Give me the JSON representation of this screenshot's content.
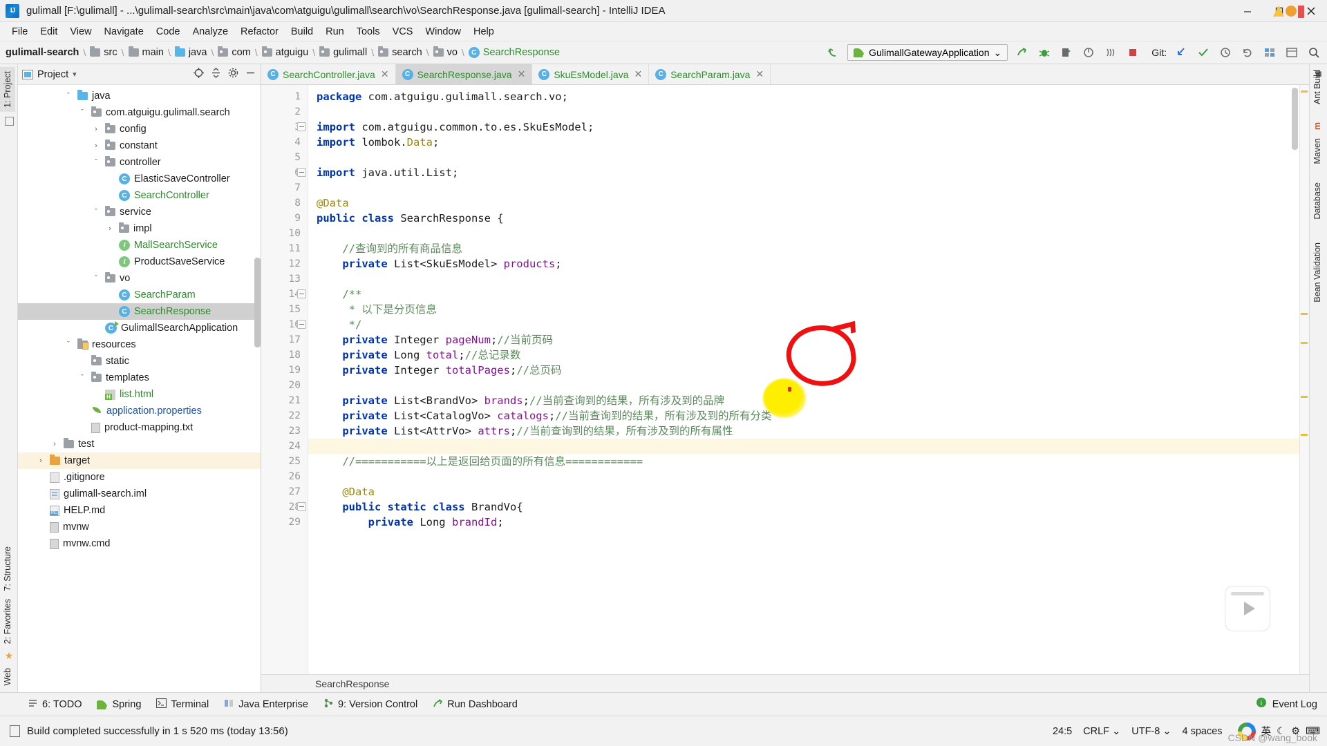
{
  "window": {
    "title": "gulimall [F:\\gulimall] - ...\\gulimall-search\\src\\main\\java\\com\\atguigu\\gulimall\\search\\vo\\SearchResponse.java [gulimall-search] - IntelliJ IDEA",
    "logo_text": "IJ",
    "minimize": "─",
    "maximize": "❐",
    "close": "✕"
  },
  "menu": {
    "items": [
      "File",
      "Edit",
      "View",
      "Navigate",
      "Code",
      "Analyze",
      "Refactor",
      "Build",
      "Run",
      "Tools",
      "VCS",
      "Window",
      "Help"
    ]
  },
  "breadcrumb": {
    "items": [
      {
        "label": "gulimall-search",
        "icon": "module-icon",
        "type": "root"
      },
      {
        "label": "src",
        "icon": "folder-icon",
        "type": "folder"
      },
      {
        "label": "main",
        "icon": "folder-icon",
        "type": "folder"
      },
      {
        "label": "java",
        "icon": "source-folder-icon",
        "type": "source"
      },
      {
        "label": "com",
        "icon": "package-icon",
        "type": "folder"
      },
      {
        "label": "atguigu",
        "icon": "package-icon",
        "type": "folder"
      },
      {
        "label": "gulimall",
        "icon": "package-icon",
        "type": "folder"
      },
      {
        "label": "search",
        "icon": "package-icon",
        "type": "folder"
      },
      {
        "label": "vo",
        "icon": "package-icon",
        "type": "folder"
      },
      {
        "label": "SearchResponse",
        "icon": "class-icon",
        "type": "class"
      }
    ],
    "separator": "\\"
  },
  "toolbar": {
    "back_icon": "undo-arrow-icon",
    "run_config": {
      "label": "GulimallGatewayApplication",
      "icon": "spring-boot-icon",
      "chevron": "⌄"
    },
    "buttons": [
      {
        "name": "run-button",
        "glyph": "➤"
      },
      {
        "name": "debug-button",
        "glyph": "☣"
      },
      {
        "name": "run-with-coverage-button",
        "glyph": "◧"
      },
      {
        "name": "profile-button",
        "glyph": "◔"
      },
      {
        "name": "attach-process-button",
        "glyph": "⫷"
      },
      {
        "name": "stop-button",
        "glyph": "■"
      }
    ],
    "git_label": "Git:",
    "git_buttons": [
      {
        "name": "update-project-button",
        "glyph": "↙"
      },
      {
        "name": "commit-button",
        "glyph": "✓"
      },
      {
        "name": "history-button",
        "glyph": "◴"
      },
      {
        "name": "rollback-button",
        "glyph": "↺"
      }
    ],
    "right_buttons": [
      {
        "name": "settings-button",
        "glyph": "▦"
      },
      {
        "name": "project-structure-button",
        "glyph": "◫"
      },
      {
        "name": "search-everywhere-button",
        "glyph": "⌕"
      }
    ]
  },
  "left_strip": {
    "top_items": [
      {
        "label": "1: Project",
        "selected": true
      },
      {
        "label": "",
        "selected": false
      }
    ],
    "bottom_items": [
      {
        "label": "7: Structure"
      },
      {
        "label": "2: Favorites"
      },
      {
        "label": "Web"
      }
    ]
  },
  "right_strip": {
    "items": [
      {
        "label": "Ant Build"
      },
      {
        "label": "m"
      },
      {
        "label": "Maven"
      },
      {
        "label": "Database"
      },
      {
        "label": "Bean Validation"
      }
    ]
  },
  "project_panel": {
    "header": {
      "title": "Project",
      "chevron": "▾",
      "icons": [
        {
          "name": "scroll-from-source-icon",
          "glyph": "⊕"
        },
        {
          "name": "collapse-all-icon",
          "glyph": "≡"
        },
        {
          "name": "settings-gear-icon",
          "glyph": "⚙"
        },
        {
          "name": "hide-panel-icon",
          "glyph": "─"
        }
      ]
    },
    "tree": [
      {
        "label": "java",
        "indent": 3,
        "chev": "ˇ",
        "icon": "source-folder-icon",
        "color": "dark"
      },
      {
        "label": "com.atguigu.gulimall.search",
        "indent": 4,
        "chev": "ˇ",
        "icon": "package-icon",
        "color": "dark"
      },
      {
        "label": "config",
        "indent": 5,
        "chev": "›",
        "icon": "package-icon",
        "color": "dark"
      },
      {
        "label": "constant",
        "indent": 5,
        "chev": "›",
        "icon": "package-icon",
        "color": "dark"
      },
      {
        "label": "controller",
        "indent": 5,
        "chev": "ˇ",
        "icon": "package-icon",
        "color": "dark"
      },
      {
        "label": "ElasticSaveController",
        "indent": 6,
        "chev": "",
        "icon": "class-icon",
        "color": "dark"
      },
      {
        "label": "SearchController",
        "indent": 6,
        "chev": "",
        "icon": "class-icon",
        "color": "green"
      },
      {
        "label": "service",
        "indent": 5,
        "chev": "ˇ",
        "icon": "package-icon",
        "color": "dark"
      },
      {
        "label": "impl",
        "indent": 6,
        "chev": "›",
        "icon": "package-icon",
        "color": "dark"
      },
      {
        "label": "MallSearchService",
        "indent": 6,
        "chev": "",
        "icon": "interface-icon",
        "color": "green"
      },
      {
        "label": "ProductSaveService",
        "indent": 6,
        "chev": "",
        "icon": "interface-icon",
        "color": "dark"
      },
      {
        "label": "vo",
        "indent": 5,
        "chev": "ˇ",
        "icon": "package-icon",
        "color": "dark"
      },
      {
        "label": "SearchParam",
        "indent": 6,
        "chev": "",
        "icon": "class-icon",
        "color": "green"
      },
      {
        "label": "SearchResponse",
        "indent": 6,
        "chev": "",
        "icon": "class-icon",
        "color": "green",
        "selected": true
      },
      {
        "label": "GulimallSearchApplication",
        "indent": 5,
        "chev": "",
        "icon": "spring-app-icon",
        "color": "dark"
      },
      {
        "label": "resources",
        "indent": 3,
        "chev": "ˇ",
        "icon": "resources-folder-icon",
        "color": "dark"
      },
      {
        "label": "static",
        "indent": 4,
        "chev": "",
        "icon": "package-icon",
        "color": "dark"
      },
      {
        "label": "templates",
        "indent": 4,
        "chev": "ˇ",
        "icon": "package-icon",
        "color": "dark"
      },
      {
        "label": "list.html",
        "indent": 5,
        "chev": "",
        "icon": "html-file-icon",
        "color": "green"
      },
      {
        "label": "application.properties",
        "indent": 4,
        "chev": "",
        "icon": "properties-file-icon",
        "color": "blue"
      },
      {
        "label": "product-mapping.txt",
        "indent": 4,
        "chev": "",
        "icon": "text-file-icon",
        "color": "dark"
      },
      {
        "label": "test",
        "indent": 2,
        "chev": "›",
        "icon": "folder-icon",
        "color": "dark"
      },
      {
        "label": "target",
        "indent": 1,
        "chev": "›",
        "icon": "target-folder-icon",
        "color": "dark",
        "highlight": true
      },
      {
        "label": ".gitignore",
        "indent": 1,
        "chev": "",
        "icon": "gitignore-file-icon",
        "color": "dark"
      },
      {
        "label": "gulimall-search.iml",
        "indent": 1,
        "chev": "",
        "icon": "iml-file-icon",
        "color": "dark"
      },
      {
        "label": "HELP.md",
        "indent": 1,
        "chev": "",
        "icon": "markdown-file-icon",
        "color": "dark"
      },
      {
        "label": "mvnw",
        "indent": 1,
        "chev": "",
        "icon": "text-file-icon",
        "color": "dark"
      },
      {
        "label": "mvnw.cmd",
        "indent": 1,
        "chev": "",
        "icon": "text-file-icon",
        "color": "dark"
      }
    ]
  },
  "editor": {
    "tabs": [
      {
        "label": "SearchController.java",
        "icon": "class-icon",
        "color": "green",
        "active": false,
        "close": "✕"
      },
      {
        "label": "SearchResponse.java",
        "icon": "class-icon",
        "color": "green",
        "active": true,
        "close": "✕"
      },
      {
        "label": "SkuEsModel.java",
        "icon": "class-icon",
        "color": "green",
        "active": false,
        "close": "✕"
      },
      {
        "label": "SearchParam.java",
        "icon": "class-icon",
        "color": "green",
        "active": false,
        "close": "✕"
      }
    ],
    "breadcrumb_status": "SearchResponse",
    "first_line": 1,
    "lines": [
      {
        "n": 1,
        "tokens": [
          {
            "t": "package ",
            "c": "kw"
          },
          {
            "t": "com.atguigu.gulimall.search.vo;",
            "c": "typ"
          }
        ]
      },
      {
        "n": 2,
        "tokens": []
      },
      {
        "n": 3,
        "fold": "minus",
        "tokens": [
          {
            "t": "import ",
            "c": "kw"
          },
          {
            "t": "com.atguigu.common.to.es.SkuEsModel;",
            "c": "typ"
          }
        ]
      },
      {
        "n": 4,
        "tokens": [
          {
            "t": "import ",
            "c": "kw"
          },
          {
            "t": "lombok.",
            "c": "typ"
          },
          {
            "t": "Data",
            "c": "yellowish"
          },
          {
            "t": ";",
            "c": "typ"
          }
        ]
      },
      {
        "n": 5,
        "tokens": []
      },
      {
        "n": 6,
        "fold": "minus",
        "tokens": [
          {
            "t": "import ",
            "c": "kw"
          },
          {
            "t": "java.util.List;",
            "c": "typ"
          }
        ]
      },
      {
        "n": 7,
        "tokens": []
      },
      {
        "n": 8,
        "tokens": [
          {
            "t": "@Data",
            "c": "anno"
          }
        ]
      },
      {
        "n": 9,
        "tokens": [
          {
            "t": "public ",
            "c": "kw"
          },
          {
            "t": "class ",
            "c": "kw"
          },
          {
            "t": "SearchResponse {",
            "c": "typ"
          }
        ]
      },
      {
        "n": 10,
        "tokens": []
      },
      {
        "n": 11,
        "tokens": [
          {
            "t": "    //查询到的所有商品信息",
            "c": "cmt-cn"
          }
        ]
      },
      {
        "n": 12,
        "tokens": [
          {
            "t": "    ",
            "c": "typ"
          },
          {
            "t": "private ",
            "c": "kw"
          },
          {
            "t": "List<SkuEsModel> ",
            "c": "typ"
          },
          {
            "t": "products",
            "c": "fld"
          },
          {
            "t": ";",
            "c": "typ"
          }
        ]
      },
      {
        "n": 13,
        "tokens": []
      },
      {
        "n": 14,
        "fold": "minus",
        "tokens": [
          {
            "t": "    /**",
            "c": "cmt-cn"
          }
        ]
      },
      {
        "n": 15,
        "tokens": [
          {
            "t": "     * 以下是分页信息",
            "c": "cmt-cn"
          }
        ]
      },
      {
        "n": 16,
        "fold": "minus",
        "tokens": [
          {
            "t": "     */",
            "c": "cmt-cn"
          }
        ]
      },
      {
        "n": 17,
        "tokens": [
          {
            "t": "    ",
            "c": "typ"
          },
          {
            "t": "private ",
            "c": "kw"
          },
          {
            "t": "Integer ",
            "c": "typ"
          },
          {
            "t": "pageNum",
            "c": "fld"
          },
          {
            "t": ";",
            "c": "typ"
          },
          {
            "t": "//当前页码",
            "c": "cmt-cn"
          }
        ]
      },
      {
        "n": 18,
        "tokens": [
          {
            "t": "    ",
            "c": "typ"
          },
          {
            "t": "private ",
            "c": "kw"
          },
          {
            "t": "Long ",
            "c": "typ"
          },
          {
            "t": "total",
            "c": "fld"
          },
          {
            "t": ";",
            "c": "typ"
          },
          {
            "t": "//总记录数",
            "c": "cmt-cn"
          }
        ]
      },
      {
        "n": 19,
        "tokens": [
          {
            "t": "    ",
            "c": "typ"
          },
          {
            "t": "private ",
            "c": "kw"
          },
          {
            "t": "Integer ",
            "c": "typ"
          },
          {
            "t": "totalPages",
            "c": "fld"
          },
          {
            "t": ";",
            "c": "typ"
          },
          {
            "t": "//总页码",
            "c": "cmt-cn"
          }
        ]
      },
      {
        "n": 20,
        "tokens": []
      },
      {
        "n": 21,
        "tokens": [
          {
            "t": "    ",
            "c": "typ"
          },
          {
            "t": "private ",
            "c": "kw"
          },
          {
            "t": "List<BrandVo> ",
            "c": "typ"
          },
          {
            "t": "brands",
            "c": "fld"
          },
          {
            "t": ";",
            "c": "typ"
          },
          {
            "t": "//当前查询到的结果，所有涉及到的品牌",
            "c": "cmt-cn"
          }
        ]
      },
      {
        "n": 22,
        "tokens": [
          {
            "t": "    ",
            "c": "typ"
          },
          {
            "t": "private ",
            "c": "kw"
          },
          {
            "t": "List<CatalogVo> ",
            "c": "typ"
          },
          {
            "t": "catalogs",
            "c": "fld"
          },
          {
            "t": ";",
            "c": "typ"
          },
          {
            "t": "//当前查询到的结果，所有涉及到的所有分类",
            "c": "cmt-cn"
          }
        ]
      },
      {
        "n": 23,
        "tokens": [
          {
            "t": "    ",
            "c": "typ"
          },
          {
            "t": "private ",
            "c": "kw"
          },
          {
            "t": "List<AttrVo> ",
            "c": "typ"
          },
          {
            "t": "attrs",
            "c": "fld"
          },
          {
            "t": ";",
            "c": "typ"
          },
          {
            "t": "//当前查询到的结果，所有涉及到的所有属性",
            "c": "cmt-cn"
          }
        ]
      },
      {
        "n": 24,
        "highlight": true,
        "tokens": []
      },
      {
        "n": 25,
        "tokens": [
          {
            "t": "    //===========以上是返回给页面的所有信息============",
            "c": "cmt-cn"
          }
        ]
      },
      {
        "n": 26,
        "tokens": []
      },
      {
        "n": 27,
        "tokens": [
          {
            "t": "    @Data",
            "c": "anno"
          }
        ]
      },
      {
        "n": 28,
        "fold": "minus",
        "tokens": [
          {
            "t": "    ",
            "c": "typ"
          },
          {
            "t": "public ",
            "c": "kw"
          },
          {
            "t": "static ",
            "c": "kw"
          },
          {
            "t": "class ",
            "c": "kw"
          },
          {
            "t": "BrandVo{",
            "c": "typ"
          }
        ]
      },
      {
        "n": 29,
        "tokens": [
          {
            "t": "        ",
            "c": "typ"
          },
          {
            "t": "private ",
            "c": "kw"
          },
          {
            "t": "Long ",
            "c": "typ"
          },
          {
            "t": "brandId",
            "c": "fld"
          },
          {
            "t": ";",
            "c": "typ"
          }
        ]
      }
    ]
  },
  "annotations": {
    "red_circle": {
      "shape": "hand-drawn-circle",
      "color": "#ee1111",
      "around": "products"
    },
    "yellow_blob": {
      "shape": "highlighter-blob",
      "color": "#ffee00"
    }
  },
  "bottom_bar": {
    "items": [
      {
        "label": "6: TODO",
        "icon": "todo-icon"
      },
      {
        "label": "Spring",
        "icon": "spring-icon"
      },
      {
        "label": "Terminal",
        "icon": "terminal-icon"
      },
      {
        "label": "Java Enterprise",
        "icon": "java-enterprise-icon"
      },
      {
        "label": "9: Version Control",
        "icon": "version-control-icon"
      },
      {
        "label": "Run Dashboard",
        "icon": "run-dashboard-icon"
      }
    ],
    "event_log": {
      "label": "Event Log",
      "icon": "event-log-icon"
    }
  },
  "statusbar": {
    "message": "Build completed successfully in 1 s 520 ms (today 13:56)",
    "caret": "24:5",
    "line_separator": "CRLF",
    "encoding": "UTF-8",
    "indent": "4 spaces",
    "encoding_chevron": "⌄",
    "sep_chevron": "⌄",
    "ime_lang": "英",
    "watermark": "CSDN @wang_book",
    "icons": [
      {
        "name": "lock-icon",
        "glyph": "🔒"
      },
      {
        "name": "ime-keyboard-icon",
        "glyph": "⌨"
      },
      {
        "name": "ime-tool-icon",
        "glyph": "⚙"
      },
      {
        "name": "ime-crescent-icon",
        "glyph": "☾"
      }
    ]
  }
}
